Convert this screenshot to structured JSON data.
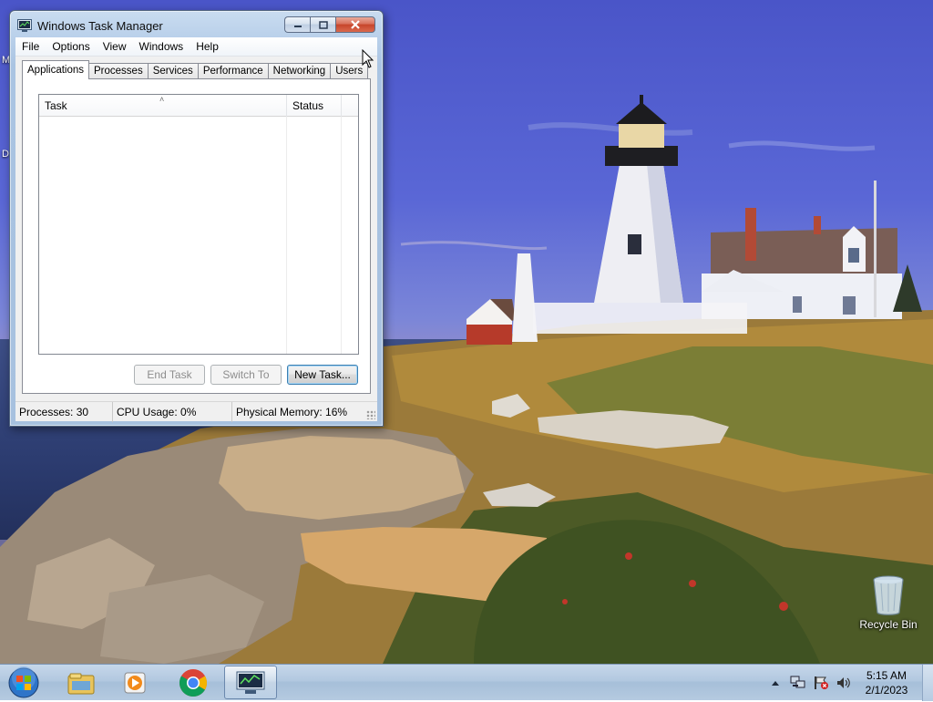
{
  "window": {
    "title": "Windows Task Manager",
    "menu": [
      "File",
      "Options",
      "View",
      "Windows",
      "Help"
    ],
    "tabs": [
      "Applications",
      "Processes",
      "Services",
      "Performance",
      "Networking",
      "Users"
    ],
    "active_tab": "Applications",
    "columns": {
      "task": "Task",
      "status": "Status"
    },
    "buttons": {
      "end_task": "End Task",
      "switch_to": "Switch To",
      "new_task": "New Task..."
    },
    "status": {
      "processes": "Processes: 30",
      "cpu": "CPU Usage: 0%",
      "memory": "Physical Memory: 16%"
    }
  },
  "desktop": {
    "icons": [
      {
        "label": "Recycle Bin",
        "icon": "recycle-bin-icon"
      }
    ]
  },
  "taskbar": {
    "pinned": [
      "windows-explorer-icon",
      "media-player-icon",
      "chrome-icon",
      "task-manager-icon"
    ],
    "tray": [
      "show-hidden-icons-icon",
      "network-icon",
      "action-center-icon",
      "volume-icon"
    ],
    "clock": {
      "time": "5:15 AM",
      "date": "2/1/2023"
    }
  }
}
